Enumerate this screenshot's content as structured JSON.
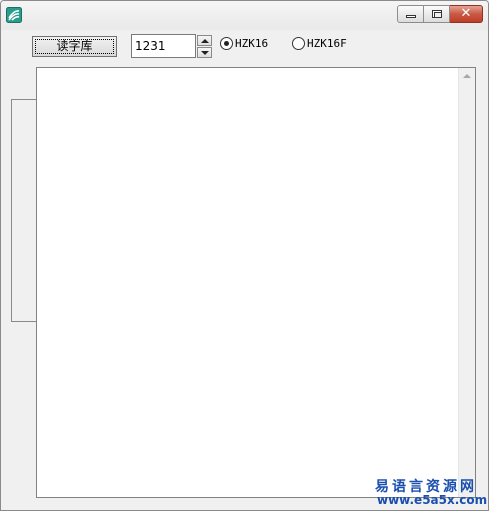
{
  "read_button_label": "读字库",
  "number_input": {
    "value": "1231"
  },
  "radio_options": [
    {
      "label": "HZK16",
      "selected": true
    },
    {
      "label": "HZK16F",
      "selected": false
    }
  ],
  "window_controls": {
    "close_symbol": "✕"
  },
  "watermark": {
    "line1": "易语言资源网",
    "line2": "www.e5a5x.com"
  },
  "icons": [
    "app-icon",
    "minimize-icon",
    "maximize-icon",
    "close-icon",
    "spin-up-icon",
    "spin-down-icon",
    "scroll-up-arrow-icon"
  ],
  "colors": {
    "close_button": "#c75a45",
    "watermark": "#1b4fae",
    "app_icon": "#2a9c8c"
  }
}
